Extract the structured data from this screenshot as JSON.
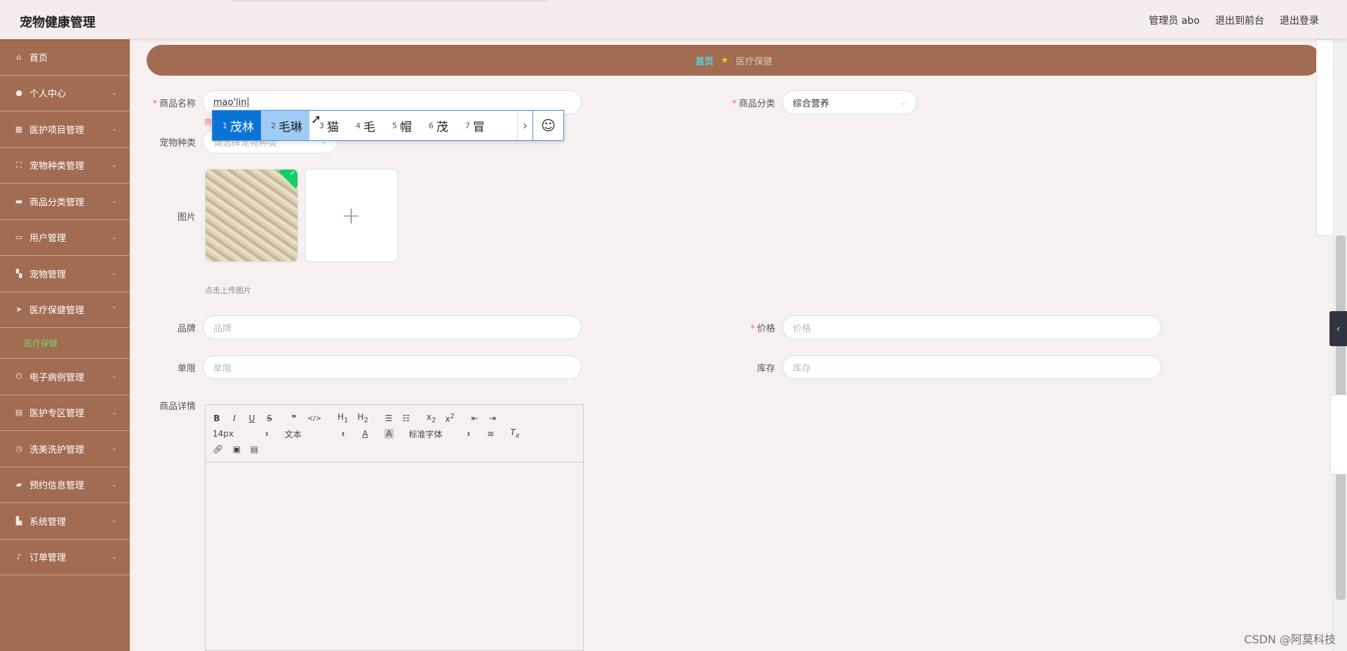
{
  "header": {
    "app_title": "宠物健康管理",
    "admin_label": "管理员 abo",
    "to_front": "退出到前台",
    "logout": "退出登录"
  },
  "sidebar": {
    "items": [
      {
        "label": "首页",
        "icon": "home-icon"
      },
      {
        "label": "个人中心",
        "icon": "user-icon"
      },
      {
        "label": "医护项目管理",
        "icon": "grid-icon"
      },
      {
        "label": "宠物种类管理",
        "icon": "fullscreen-icon"
      },
      {
        "label": "商品分类管理",
        "icon": "printer-icon"
      },
      {
        "label": "用户管理",
        "icon": "briefcase-icon"
      },
      {
        "label": "宠物管理",
        "icon": "menu-icon"
      },
      {
        "label": "医疗保健管理",
        "icon": "send-icon"
      },
      {
        "label": "电子病例管理",
        "icon": "power-icon"
      },
      {
        "label": "医护专区管理",
        "icon": "delete-icon"
      },
      {
        "label": "洗美洗护管理",
        "icon": "clock-icon"
      },
      {
        "label": "预约信息管理",
        "icon": "ticket-icon"
      },
      {
        "label": "系统管理",
        "icon": "shop-icon"
      },
      {
        "label": "订单管理",
        "icon": "mic-icon"
      }
    ],
    "active_sub": "医疗保健"
  },
  "breadcrumb": {
    "home": "首页",
    "current": "医疗保健"
  },
  "form": {
    "name_label": "商品名称",
    "name_value": "mao'lin",
    "name_error": "商",
    "category_label": "商品分类",
    "category_value": "综合营养",
    "pet_type_label": "宠物种类",
    "pet_type_placeholder": "请选择宠物种类",
    "image_label": "图片",
    "upload_hint": "点击上传图片",
    "brand_label": "品牌",
    "brand_placeholder": "品牌",
    "price_label": "价格",
    "price_placeholder": "价格",
    "limit_label": "单限",
    "limit_placeholder": "单限",
    "stock_label": "库存",
    "stock_placeholder": "库存",
    "detail_label": "商品详情"
  },
  "editor": {
    "font_size": "14px",
    "block_type": "文本",
    "font_family": "标准字体"
  },
  "ime": {
    "candidates": [
      {
        "num": "1",
        "text": "茂林"
      },
      {
        "num": "2",
        "text": "毛琳"
      },
      {
        "num": "3",
        "text": "猫"
      },
      {
        "num": "4",
        "text": "毛"
      },
      {
        "num": "5",
        "text": "帽"
      },
      {
        "num": "6",
        "text": "茂"
      },
      {
        "num": "7",
        "text": "冒"
      }
    ]
  },
  "watermark": "CSDN @阿莫科技",
  "colors": {
    "sidebar_bg": "#a26c52",
    "active_sub": "#7bd16a",
    "breadcrumb_home": "#5ad2e0",
    "required": "#f56c6c"
  }
}
